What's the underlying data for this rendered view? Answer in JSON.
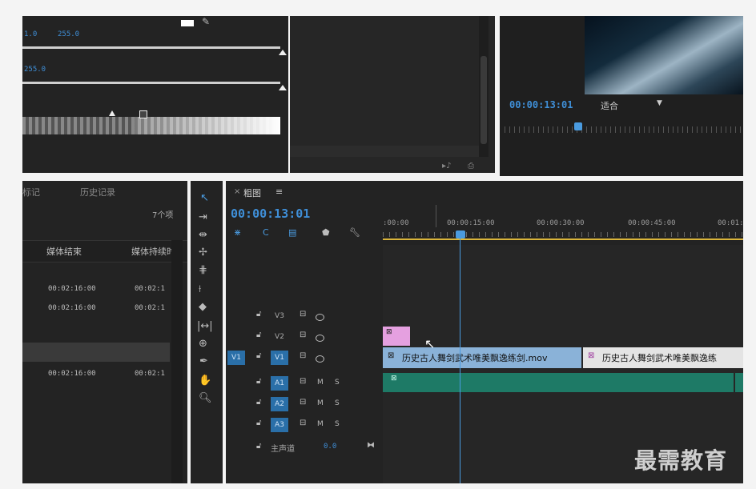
{
  "effect_controls": {
    "val_a": "1.0",
    "val_b": "255.0",
    "val_c": "255.0"
  },
  "program_monitor": {
    "timecode": "00:00:13:01",
    "fit_label": "适合"
  },
  "project_panel": {
    "tabs": [
      "标记",
      "历史记录"
    ],
    "item_count": "7个项",
    "columns": [
      "媒体结束",
      "媒体持续时"
    ],
    "rows": [
      {
        "end": "00:02:16:00",
        "dur": "00:02:1"
      },
      {
        "end": "00:02:16:00",
        "dur": "00:02:1"
      },
      {
        "end": "00:02:16:00",
        "dur": "00:02:1"
      }
    ]
  },
  "timeline": {
    "close": "×",
    "title": "粗图",
    "menu": "≡",
    "timecode": "00:00:13:01",
    "ruler": [
      ":00:00",
      "00:00:15:00",
      "00:00:30:00",
      "00:00:45:00",
      "00:01:"
    ],
    "tracks": [
      {
        "name": "V3",
        "type": "video",
        "source": ""
      },
      {
        "name": "V2",
        "type": "video",
        "source": ""
      },
      {
        "name": "V1",
        "type": "video",
        "source": "V1"
      },
      {
        "name": "A1",
        "type": "audio",
        "source": ""
      },
      {
        "name": "A2",
        "type": "audio",
        "source": ""
      },
      {
        "name": "A3",
        "type": "audio",
        "source": ""
      }
    ],
    "mute_label": "M",
    "solo_label": "S",
    "master": {
      "label": "主声道",
      "value": "0.0"
    },
    "clips": {
      "v1_first": "历史古人舞剑武术唯美飘逸练剑.mov",
      "v1_second": "历史古人舞剑武术唯美飘逸练"
    }
  },
  "watermark": "最需教育",
  "colors": {
    "accent_blue": "#3f8fd8",
    "playhead": "#4a9be0",
    "clip_blue": "#8ab2d8",
    "clip_pink": "#e5a0e0",
    "clip_audio": "#1e7a66",
    "work_area": "#d9b43a"
  }
}
